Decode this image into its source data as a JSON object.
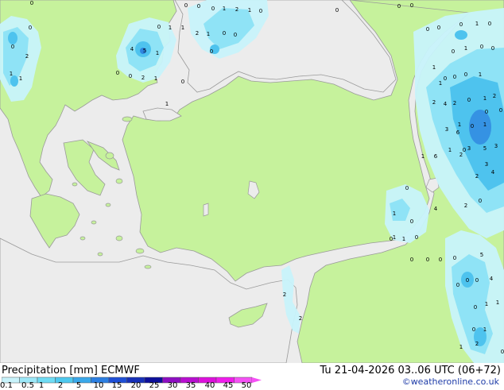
{
  "header": {
    "left_title": "Precipitation [mm]  ECMWF",
    "right_title": "Tu 21-04-2026 03..06 UTC (06+72)",
    "credit": "©weatheronline.co.uk"
  },
  "legend": {
    "ticks": [
      "0.1",
      "0.5",
      "1",
      "2",
      "5",
      "10",
      "15",
      "20",
      "25",
      "30",
      "35",
      "40",
      "45",
      "50"
    ],
    "colors": [
      "#c8f3fb",
      "#9ce8f8",
      "#6fdcf4",
      "#4ec9ef",
      "#3aa8ea",
      "#2c7fe2",
      "#1f4fd6",
      "#1730b8",
      "#0d0f9a",
      "#8e0ec2",
      "#b80ed0",
      "#dd10dc",
      "#f01cec",
      "#f551f5"
    ]
  },
  "colors": {
    "sea": "#ececec",
    "land": "#c6f29c",
    "coast": "#9a9a9a",
    "precip_light": "#c8f3fb",
    "precip_mid": "#8fe3f6",
    "precip_heavy": "#4ec3ee",
    "precip_core": "#2f86e0"
  },
  "map_values": [
    {
      "v": "0"
    },
    {
      "v": "0"
    },
    {
      "v": "0"
    },
    {
      "v": "0"
    },
    {
      "v": "1"
    },
    {
      "v": "2"
    },
    {
      "v": "1"
    },
    {
      "v": "0"
    },
    {
      "v": "0"
    },
    {
      "v": "0"
    },
    {
      "v": "0"
    },
    {
      "v": "0"
    },
    {
      "v": "0"
    },
    {
      "v": "1"
    },
    {
      "v": "1"
    },
    {
      "v": "2"
    },
    {
      "v": "1"
    },
    {
      "v": "0"
    },
    {
      "v": "0"
    },
    {
      "v": "4"
    },
    {
      "v": "5"
    },
    {
      "v": "1"
    },
    {
      "v": "0"
    },
    {
      "v": "0"
    },
    {
      "v": "0"
    },
    {
      "v": "2"
    },
    {
      "v": "1"
    },
    {
      "v": "0"
    },
    {
      "v": "1"
    },
    {
      "v": "0"
    },
    {
      "v": "2"
    },
    {
      "v": "1"
    },
    {
      "v": "1"
    },
    {
      "v": "0"
    },
    {
      "v": "0"
    },
    {
      "v": "0"
    },
    {
      "v": "1"
    },
    {
      "v": "0"
    },
    {
      "v": "1"
    },
    {
      "v": "0"
    },
    {
      "v": "0"
    },
    {
      "v": "0"
    },
    {
      "v": "1"
    },
    {
      "v": "0"
    },
    {
      "v": "0"
    },
    {
      "v": "0"
    },
    {
      "v": "1"
    },
    {
      "v": "1"
    },
    {
      "v": "2"
    },
    {
      "v": "0"
    },
    {
      "v": "1"
    },
    {
      "v": "2"
    },
    {
      "v": "2"
    },
    {
      "v": "4"
    },
    {
      "v": "1"
    },
    {
      "v": "0"
    },
    {
      "v": "1"
    },
    {
      "v": "3"
    },
    {
      "v": "6"
    },
    {
      "v": "0"
    },
    {
      "v": "0"
    },
    {
      "v": "3"
    },
    {
      "v": "5"
    },
    {
      "v": "3"
    },
    {
      "v": "1"
    },
    {
      "v": "0"
    },
    {
      "v": "4"
    },
    {
      "v": "2"
    },
    {
      "v": "2"
    },
    {
      "v": "3"
    },
    {
      "v": "0"
    },
    {
      "v": "2"
    },
    {
      "v": "6"
    },
    {
      "v": "1"
    },
    {
      "v": "0"
    },
    {
      "v": "4"
    },
    {
      "v": "1"
    },
    {
      "v": "0"
    },
    {
      "v": "1"
    },
    {
      "v": "0"
    },
    {
      "v": "0"
    },
    {
      "v": "0"
    },
    {
      "v": "0"
    },
    {
      "v": "0"
    },
    {
      "v": "0"
    },
    {
      "v": "0"
    },
    {
      "v": "4"
    },
    {
      "v": "5"
    },
    {
      "v": "1"
    },
    {
      "v": "0"
    },
    {
      "v": "1"
    },
    {
      "v": "0"
    },
    {
      "v": "1"
    },
    {
      "v": "2"
    },
    {
      "v": "1"
    },
    {
      "v": "2"
    },
    {
      "v": "2"
    },
    {
      "v": "0"
    },
    {
      "v": "0"
    },
    {
      "v": "1"
    },
    {
      "v": "0"
    }
  ]
}
